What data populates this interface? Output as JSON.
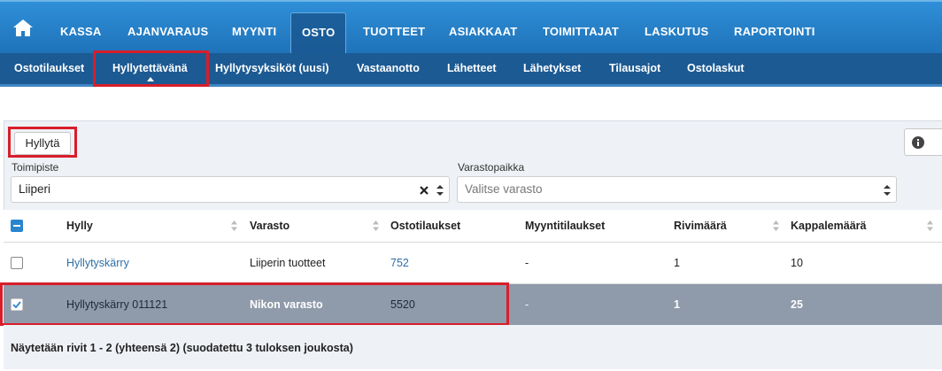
{
  "top_nav": {
    "items": [
      "KASSA",
      "AJANVARAUS",
      "MYYNTI",
      "OSTO",
      "TUOTTEET",
      "ASIAKKAAT",
      "TOIMITTAJAT",
      "LASKUTUS",
      "RAPORTOINTI"
    ],
    "active": "OSTO"
  },
  "sub_nav": {
    "items": [
      "Ostotilaukset",
      "Hyllytettävänä",
      "Hyllytysyksiköt (uusi)",
      "Vastaanotto",
      "Lähetteet",
      "Lähetykset",
      "Tilausajot",
      "Ostolaskut"
    ],
    "active": "Hyllytettävänä"
  },
  "toolbar": {
    "shelve_button": "Hyllytä"
  },
  "filters": {
    "toimipiste_label": "Toimipiste",
    "toimipiste_value": "Liiperi",
    "varastopaikka_label": "Varastopaikka",
    "varastopaikka_placeholder": "Valitse varasto"
  },
  "table": {
    "columns": [
      "Hylly",
      "Varasto",
      "Ostotilaukset",
      "Myyntitilaukset",
      "Rivimäärä",
      "Kappalemäärä"
    ],
    "rows": [
      {
        "hylly": "Hyllytyskärry",
        "varasto": "Liiperin tuotteet",
        "ostotilaukset": "752",
        "myyntitilaukset": "-",
        "rivimaara": "1",
        "kappalemaara": "10",
        "checked": false
      },
      {
        "hylly": "Hyllytyskärry 011121",
        "varasto": "Nikon varasto",
        "ostotilaukset": "5520",
        "myyntitilaukset": "-",
        "rivimaara": "1",
        "kappalemaara": "25",
        "checked": true
      }
    ]
  },
  "footer": {
    "text": "Näytetään rivit 1 - 2 (yhteensä 2) (suodatettu 3 tuloksen joukosta)"
  },
  "colors": {
    "nav_blue": "#2a85cf",
    "subnav_blue": "#1c5a93",
    "selected_row": "#8f9aaa",
    "highlight_red": "#d81e2a",
    "link": "#2d6fa8"
  }
}
